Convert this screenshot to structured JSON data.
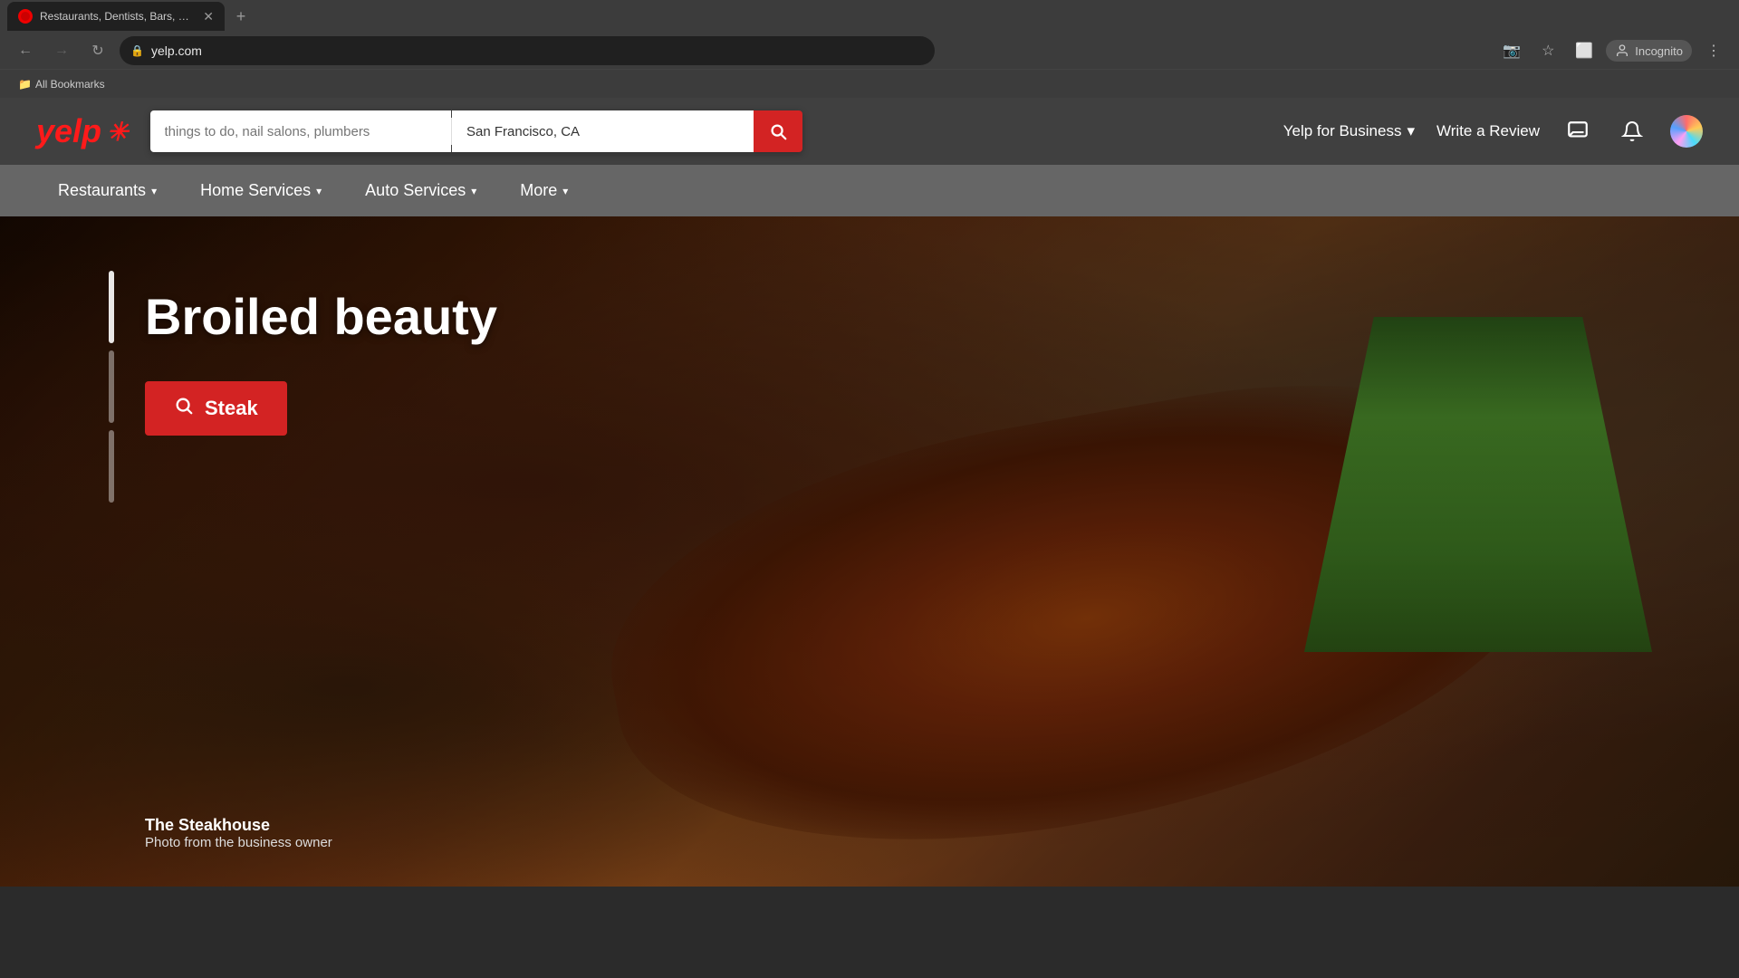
{
  "browser": {
    "url": "yelp.com",
    "tab_title": "Restaurants, Dentists, Bars, Bea...",
    "tab_new_label": "+",
    "incognito_label": "Incognito",
    "bookmarks_label": "All Bookmarks"
  },
  "header": {
    "logo": "yelp",
    "logo_burst": "✳",
    "search_what_placeholder": "things to do, nail salons, plumbers",
    "search_where_value": "San Francisco, CA",
    "yelp_for_business_label": "Yelp for Business",
    "write_review_label": "Write a Review"
  },
  "nav": {
    "items": [
      {
        "label": "Restaurants",
        "has_dropdown": true
      },
      {
        "label": "Home Services",
        "has_dropdown": true
      },
      {
        "label": "Auto Services",
        "has_dropdown": true
      },
      {
        "label": "More",
        "has_dropdown": true
      }
    ]
  },
  "hero": {
    "title": "Broiled beauty",
    "cta_label": "Steak",
    "caption_title": "The Steakhouse",
    "caption_sub": "Photo from the business owner"
  }
}
